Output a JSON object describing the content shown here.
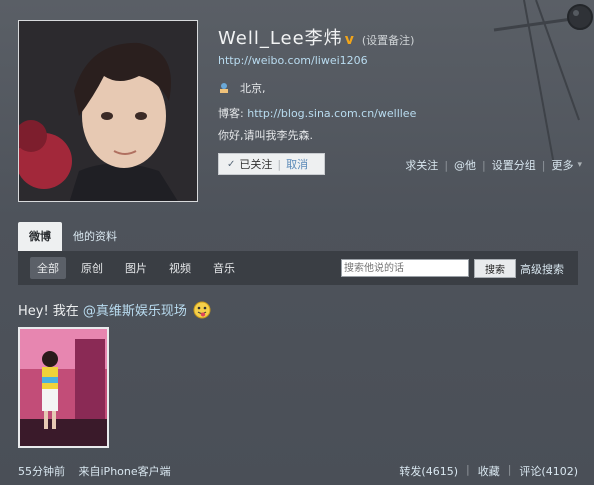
{
  "profile": {
    "name": "Well_Lee李炜",
    "v_badge": "v",
    "remark": "(设置备注)",
    "url": "http://weibo.com/liwei1206",
    "location": "北京,",
    "blog_label": "博客:",
    "blog_url": "http://blog.sina.com.cn/welllee",
    "intro": "你好,请叫我李先森."
  },
  "follow": {
    "check": "✓",
    "followed_label": "已关注",
    "separator": "|",
    "cancel_label": "取消"
  },
  "actions": [
    {
      "label": "求关注"
    },
    {
      "label": "@他"
    },
    {
      "label": "设置分组"
    },
    {
      "label": "更多"
    }
  ],
  "actions_separator": "|",
  "tabs": [
    {
      "label": "微博"
    },
    {
      "label": "他的资料"
    }
  ],
  "filters": [
    {
      "label": "全部"
    },
    {
      "label": "原创"
    },
    {
      "label": "图片"
    },
    {
      "label": "视频"
    },
    {
      "label": "音乐"
    }
  ],
  "search": {
    "placeholder": "搜索他说的话",
    "button_label": "搜索",
    "advanced_label": "高级搜索"
  },
  "post": {
    "text": "Hey! 我在",
    "mention": "@真维斯娱乐现场",
    "time": "55分钟前",
    "source": "来自iPhone客户端",
    "repost_label": "转发(4615)",
    "favorite_label": "收藏",
    "comment_label": "评论(4102)",
    "separator": "|"
  },
  "icons": {
    "v_badge": "verified-badge-icon",
    "location": "location-icon",
    "emoji": "tongue-out-emoji-icon",
    "more_caret": "caret-down-icon"
  },
  "colors": {
    "link": "#b9dcf0",
    "badge": "#f2a51a",
    "background": "#4e535b"
  }
}
